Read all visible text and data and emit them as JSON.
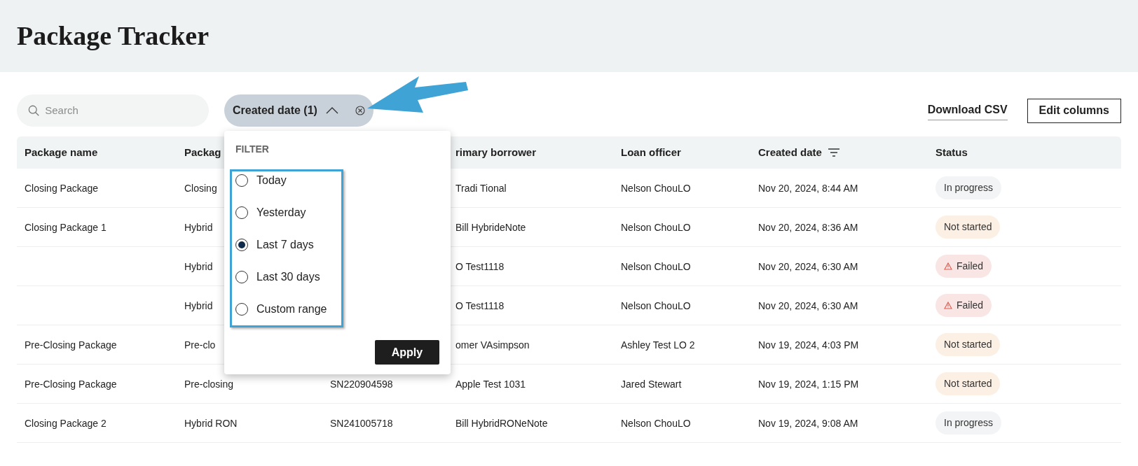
{
  "title": "Package Tracker",
  "search": {
    "placeholder": "Search"
  },
  "filter_chip": {
    "label": "Created date (1)",
    "expanded": true
  },
  "actions": {
    "download": "Download CSV",
    "edit_columns": "Edit columns"
  },
  "table": {
    "columns": [
      "Package name",
      "Packag",
      "",
      "rimary borrower",
      "Loan officer",
      "Created date",
      "Status"
    ],
    "rows": [
      {
        "cells": [
          "Closing Package",
          "Closing",
          "",
          "Tradi Tional",
          "Nelson ChouLO",
          "Nov 20, 2024, 8:44 AM"
        ],
        "status": {
          "label": "In progress",
          "kind": "in_progress"
        }
      },
      {
        "cells": [
          "Closing Package 1",
          "Hybrid",
          "",
          "Bill HybrideNote",
          "Nelson ChouLO",
          "Nov 20, 2024, 8:36 AM"
        ],
        "status": {
          "label": "Not started",
          "kind": "not_started"
        }
      },
      {
        "cells": [
          "",
          "Hybrid",
          "",
          "O Test1118",
          "Nelson ChouLO",
          "Nov 20, 2024, 6:30 AM"
        ],
        "status": {
          "label": "Failed",
          "kind": "failed"
        }
      },
      {
        "cells": [
          "",
          "Hybrid",
          "",
          "O Test1118",
          "Nelson ChouLO",
          "Nov 20, 2024, 6:30 AM"
        ],
        "status": {
          "label": "Failed",
          "kind": "failed"
        }
      },
      {
        "cells": [
          "Pre-Closing Package",
          "Pre-clo",
          "",
          "omer VAsimpson",
          "Ashley Test LO 2",
          "Nov 19, 2024, 4:03 PM"
        ],
        "status": {
          "label": "Not started",
          "kind": "not_started"
        }
      },
      {
        "cells": [
          "Pre-Closing Package",
          "Pre-closing",
          "SN220904598",
          "Apple Test 1031",
          "Jared Stewart",
          "Nov 19, 2024, 1:15 PM"
        ],
        "status": {
          "label": "Not started",
          "kind": "not_started"
        }
      },
      {
        "cells": [
          "Closing Package 2",
          "Hybrid RON",
          "SN241005718",
          "Bill HybridRONeNote",
          "Nelson ChouLO",
          "Nov 19, 2024, 9:08 AM"
        ],
        "status": {
          "label": "In progress",
          "kind": "in_progress"
        }
      }
    ]
  },
  "filter_popup": {
    "heading": "FILTER",
    "options": [
      {
        "label": "Today",
        "selected": false
      },
      {
        "label": "Yesterday",
        "selected": false
      },
      {
        "label": "Last 7 days",
        "selected": true
      },
      {
        "label": "Last 30 days",
        "selected": false
      },
      {
        "label": "Custom range",
        "selected": false
      }
    ],
    "apply": "Apply"
  }
}
